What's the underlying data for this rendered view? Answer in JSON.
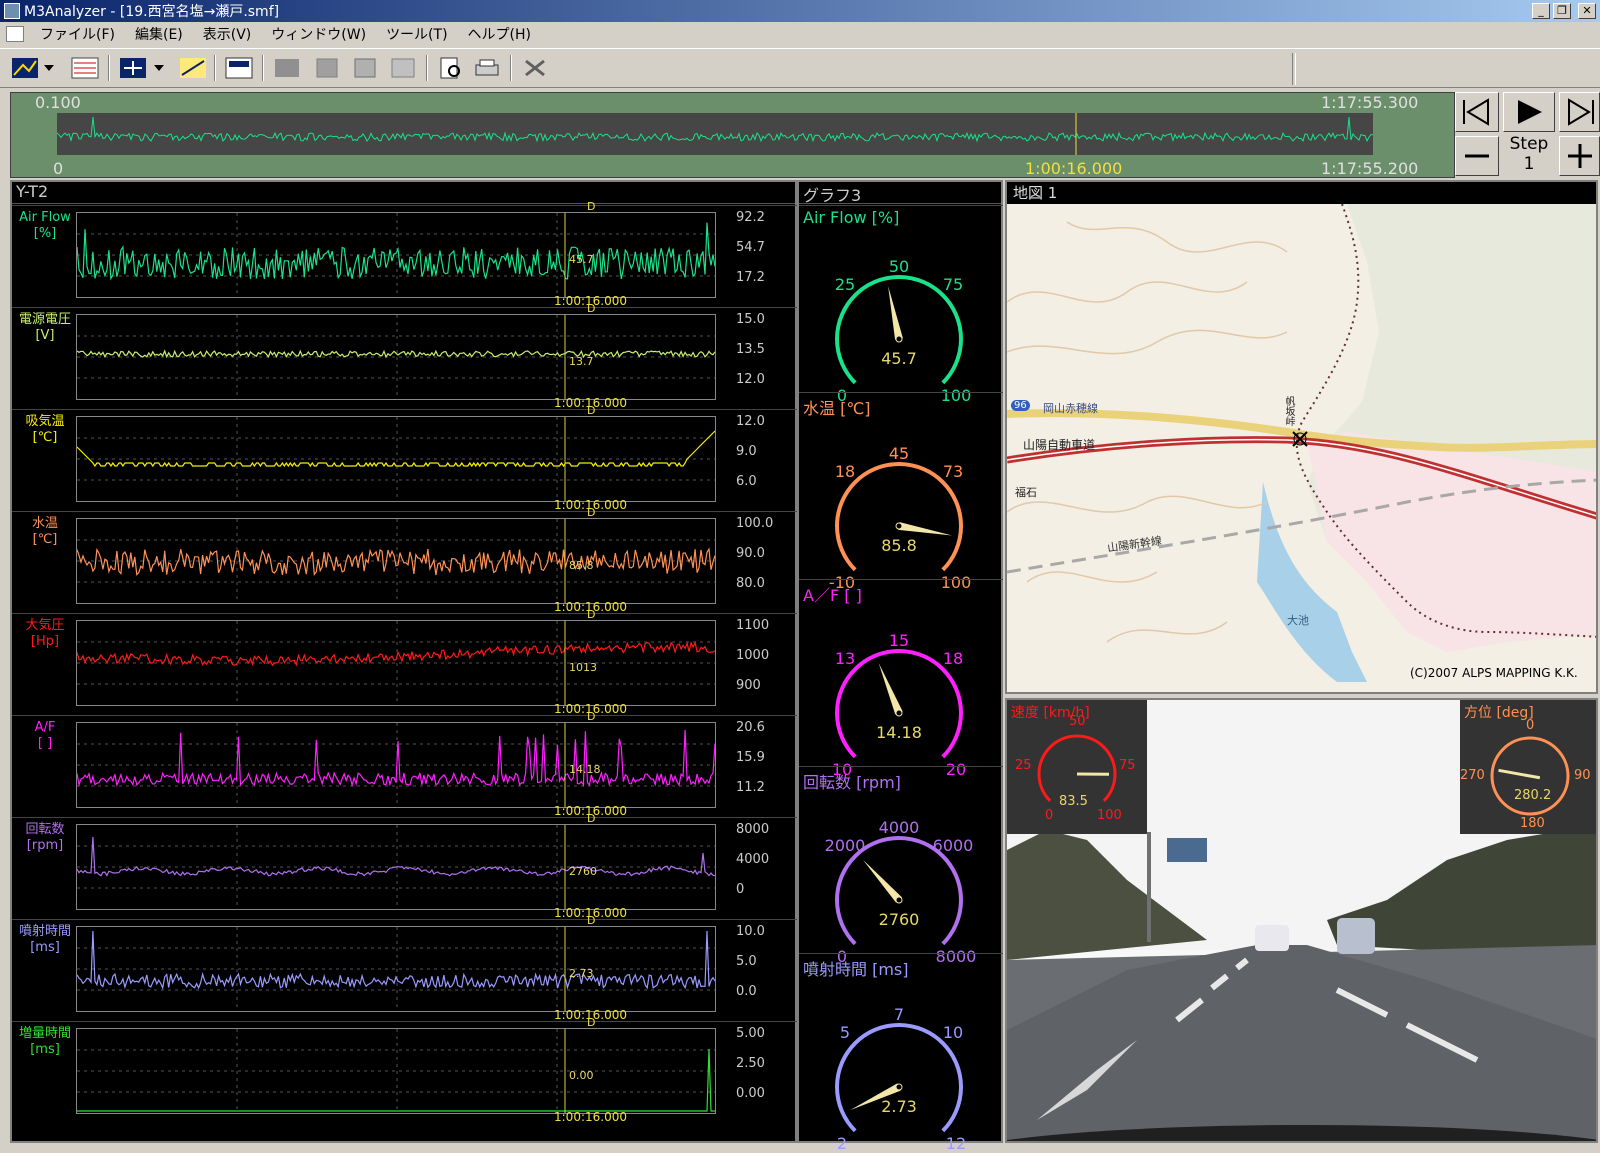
{
  "window": {
    "title": "M3Analyzer - [19.西宮名塩→瀬戸.smf]"
  },
  "menu": [
    "ファイル(F)",
    "編集(E)",
    "表示(V)",
    "ウィンドウ(W)",
    "ツール(T)",
    "ヘルプ(H)"
  ],
  "window_controls": {
    "minimize": "_",
    "restore": "❐",
    "close": "✕"
  },
  "timebar": {
    "start_top": "0.100",
    "end_top": "1:17:55.300",
    "start_bottom": "0",
    "current": "1:00:16.000",
    "end_bottom": "1:17:55.200",
    "cursor_fraction": 0.774
  },
  "step": {
    "label": "Step",
    "value": "1"
  },
  "yt": {
    "title": "Y-T2",
    "marker": "D",
    "cursor_time": "1:00:16.000",
    "channels": [
      {
        "name": "Air Flow",
        "unit": "[%]",
        "color": "#19e28a",
        "ticks": [
          "92.2",
          "54.7",
          "17.2"
        ],
        "value": "45.7"
      },
      {
        "name": "電源電圧",
        "unit": "[V]",
        "color": "#c8ef70",
        "ticks": [
          "15.0",
          "13.5",
          "12.0"
        ],
        "value": "13.7"
      },
      {
        "name": "吸気温",
        "unit": "[℃]",
        "color": "#f4f000",
        "ticks": [
          "12.0",
          "9.0",
          "6.0"
        ],
        "value": ""
      },
      {
        "name": "水温",
        "unit": "[℃]",
        "color": "#ff9155",
        "ticks": [
          "100.0",
          "90.0",
          "80.0"
        ],
        "value": "85.8"
      },
      {
        "name": "大気圧",
        "unit": "[Hp]",
        "color": "#ff1a1a",
        "ticks": [
          "1100",
          "1000",
          "900"
        ],
        "value": "1013"
      },
      {
        "name": "A/F",
        "unit": "[ ]",
        "color": "#ff20ff",
        "ticks": [
          "20.6",
          "15.9",
          "11.2"
        ],
        "value": "14.18"
      },
      {
        "name": "回転数",
        "unit": "[rpm]",
        "color": "#b070f0",
        "ticks": [
          "8000",
          "4000",
          "0"
        ],
        "value": "2760"
      },
      {
        "name": "噴射時間",
        "unit": "[ms]",
        "color": "#9a9aff",
        "ticks": [
          "10.0",
          "5.0",
          "0.0"
        ],
        "value": "2.73"
      },
      {
        "name": "増量時間",
        "unit": "[ms]",
        "color": "#30e030",
        "ticks": [
          "5.00",
          "2.50",
          "0.00"
        ],
        "value": "0.00"
      }
    ]
  },
  "graph3": {
    "title": "グラフ3",
    "gauges": [
      {
        "title": "Air Flow [%]",
        "color": "#19e28a",
        "labels": [
          "0",
          "25",
          "50",
          "75",
          "100"
        ],
        "min": 0,
        "max": 100,
        "value": 45.7,
        "display": "45.7"
      },
      {
        "title": "水温 [℃]",
        "color": "#ff9155",
        "labels": [
          "-10",
          "18",
          "45",
          "73",
          "100"
        ],
        "min": -10,
        "max": 100,
        "value": 85.8,
        "display": "85.8"
      },
      {
        "title": "A／F [ ]",
        "color": "#ff20ff",
        "labels": [
          "10",
          "13",
          "15",
          "18",
          "20"
        ],
        "min": 10,
        "max": 20,
        "value": 14.18,
        "display": "14.18"
      },
      {
        "title": "回転数 [rpm]",
        "color": "#b070f0",
        "labels": [
          "0",
          "2000",
          "4000",
          "6000",
          "8000"
        ],
        "min": 0,
        "max": 8000,
        "value": 2760,
        "display": "2760"
      },
      {
        "title": "噴射時間 [ms]",
        "color": "#9a9aff",
        "labels": [
          "2",
          "5",
          "7",
          "10",
          "12"
        ],
        "min": 2,
        "max": 12,
        "value": 2.73,
        "display": "2.73"
      }
    ]
  },
  "map": {
    "title": "地図 1",
    "copyright": "(C)2007 ALPS MAPPING K.K.",
    "labels": {
      "route": "岡山赤穂線",
      "expressway": "山陽自動車道",
      "shinkansen": "山陽新幹線",
      "station": "福石",
      "pond": "大池",
      "pass": "帆坂峠",
      "route_no": "96"
    }
  },
  "camera": {
    "speed": {
      "title": "速度 [km/h]",
      "labels": [
        "0",
        "25",
        "50",
        "75",
        "100"
      ],
      "value": 83.5,
      "display": "83.5",
      "color": "#ff1a1a"
    },
    "heading": {
      "title": "方位 [deg]",
      "labels": [
        "0",
        "90",
        "180",
        "270"
      ],
      "value": 280.2,
      "display": "280.2",
      "color": "#ff9155"
    }
  }
}
